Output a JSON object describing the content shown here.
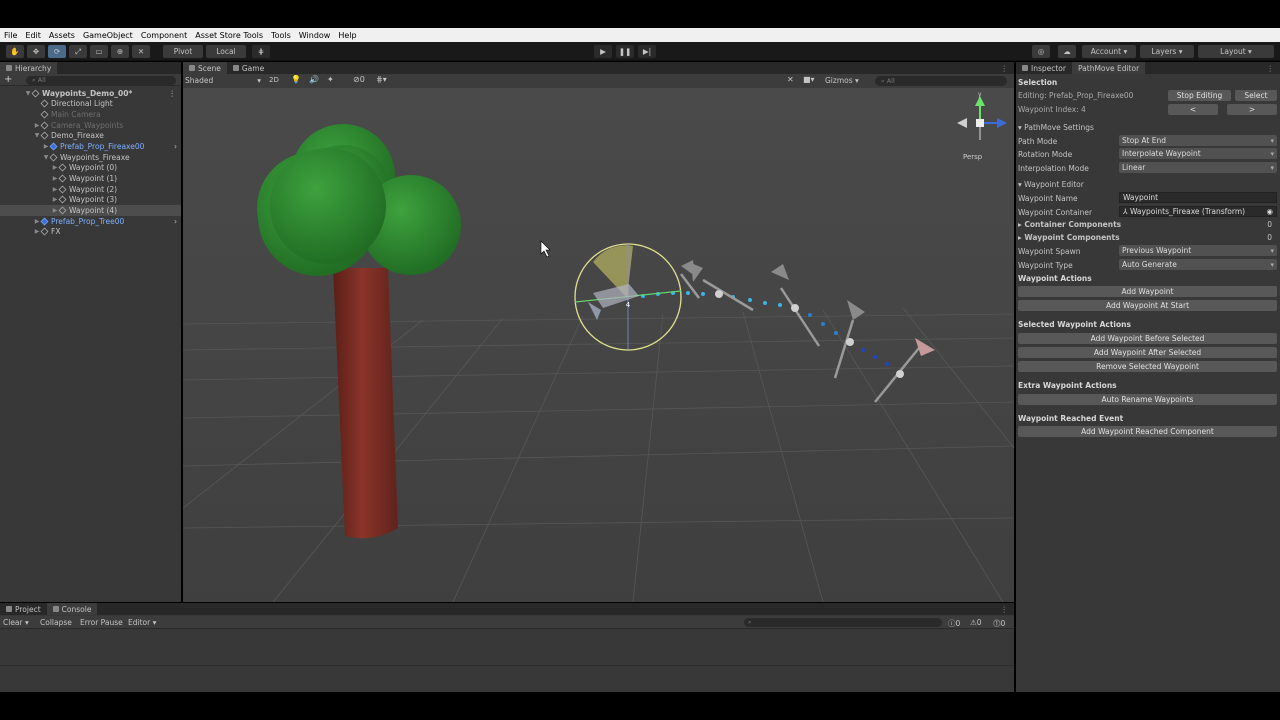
{
  "menu": [
    "File",
    "Edit",
    "Assets",
    "GameObject",
    "Component",
    "Asset Store Tools",
    "Tools",
    "Window",
    "Help"
  ],
  "toolbar": {
    "pivot": "Pivot",
    "local": "Local",
    "account": "Account",
    "layers": "Layers",
    "layout": "Layout"
  },
  "hierarchy": {
    "tab": "Hierarchy",
    "search_placeholder": "All",
    "rows": [
      {
        "label": "Waypoints_Demo_00*",
        "indent": 0,
        "arrow": "▼",
        "icon": "scene"
      },
      {
        "label": "Directional Light",
        "indent": 1,
        "arrow": "",
        "icon": "cube"
      },
      {
        "label": "Main Camera",
        "indent": 1,
        "arrow": "",
        "icon": "cube",
        "dim": true
      },
      {
        "label": "Camera_Waypoints",
        "indent": 1,
        "arrow": "▶",
        "icon": "cube",
        "dim": true
      },
      {
        "label": "Demo_Fireaxe",
        "indent": 1,
        "arrow": "▼",
        "icon": "cube"
      },
      {
        "label": "Prefab_Prop_Fireaxe00",
        "indent": 2,
        "arrow": "▶",
        "icon": "prefab",
        "blue": true
      },
      {
        "label": "Waypoints_Fireaxe",
        "indent": 2,
        "arrow": "▼",
        "icon": "cube"
      },
      {
        "label": "Waypoint (0)",
        "indent": 3,
        "arrow": "▶",
        "icon": "cube"
      },
      {
        "label": "Waypoint (1)",
        "indent": 3,
        "arrow": "▶",
        "icon": "cube"
      },
      {
        "label": "Waypoint (2)",
        "indent": 3,
        "arrow": "▶",
        "icon": "cube"
      },
      {
        "label": "Waypoint (3)",
        "indent": 3,
        "arrow": "▶",
        "icon": "cube"
      },
      {
        "label": "Waypoint (4)",
        "indent": 3,
        "arrow": "▶",
        "icon": "cube",
        "selected": true
      },
      {
        "label": "Prefab_Prop_Tree00",
        "indent": 1,
        "arrow": "▶",
        "icon": "prefab",
        "blue": true
      },
      {
        "label": "FX",
        "indent": 1,
        "arrow": "▶",
        "icon": "cube"
      }
    ]
  },
  "scene": {
    "tabs": [
      "Scene",
      "Game"
    ],
    "shading": "Shaded",
    "mode2d": "2D",
    "gizmos": "Gizmos",
    "search_placeholder": "All",
    "persp": "Persp",
    "axis_y": "y",
    "axis_x": "x",
    "waypoint_index_label": "4"
  },
  "inspector": {
    "tabs": [
      "Inspector",
      "PathMove Editor"
    ],
    "selection_header": "Selection",
    "editing": "Editing: Prefab_Prop_Fireaxe00",
    "stop_editing": "Stop Editing",
    "select": "Select",
    "waypoint_index": "Waypoint Index: 4",
    "prev": "<",
    "next": ">",
    "settings_header": "PathMove Settings",
    "path_mode_label": "Path Mode",
    "path_mode": "Stop At End",
    "rotation_mode_label": "Rotation Mode",
    "rotation_mode": "Interpolate Waypoint",
    "interp_mode_label": "Interpolation Mode",
    "interp_mode": "Linear",
    "editor_header": "Waypoint Editor",
    "wp_name_label": "Waypoint Name",
    "wp_name": "Waypoint",
    "wp_container_label": "Waypoint Container",
    "wp_container": "Waypoints_Fireaxe (Transform)",
    "container_components": "Container Components",
    "container_components_count": "0",
    "waypoint_components": "Waypoint Components",
    "waypoint_components_count": "0",
    "wp_spawn_label": "Waypoint Spawn",
    "wp_spawn": "Previous Waypoint",
    "wp_type_label": "Waypoint Type",
    "wp_type": "Auto Generate",
    "actions_header": "Waypoint Actions",
    "add_waypoint": "Add Waypoint",
    "add_waypoint_start": "Add Waypoint At Start",
    "selected_header": "Selected Waypoint Actions",
    "add_before": "Add Waypoint Before Selected",
    "add_after": "Add Waypoint After Selected",
    "remove_selected": "Remove Selected Waypoint",
    "extra_header": "Extra Waypoint Actions",
    "auto_rename": "Auto Rename Waypoints",
    "reached_header": "Waypoint Reached Event",
    "add_reached": "Add Waypoint Reached Component"
  },
  "bottom": {
    "tabs": [
      "Project",
      "Console"
    ],
    "clear": "Clear",
    "collapse": "Collapse",
    "error_pause": "Error Pause",
    "editor": "Editor",
    "count_info": "0",
    "count_warn": "0",
    "count_err": "0"
  },
  "colors": {
    "panel": "#383838",
    "scene_bg": "#474747",
    "accent_blue": "#2c5d87",
    "tree_trunk": "#7a2b22",
    "tree_leaves": "#2e8a2e"
  }
}
